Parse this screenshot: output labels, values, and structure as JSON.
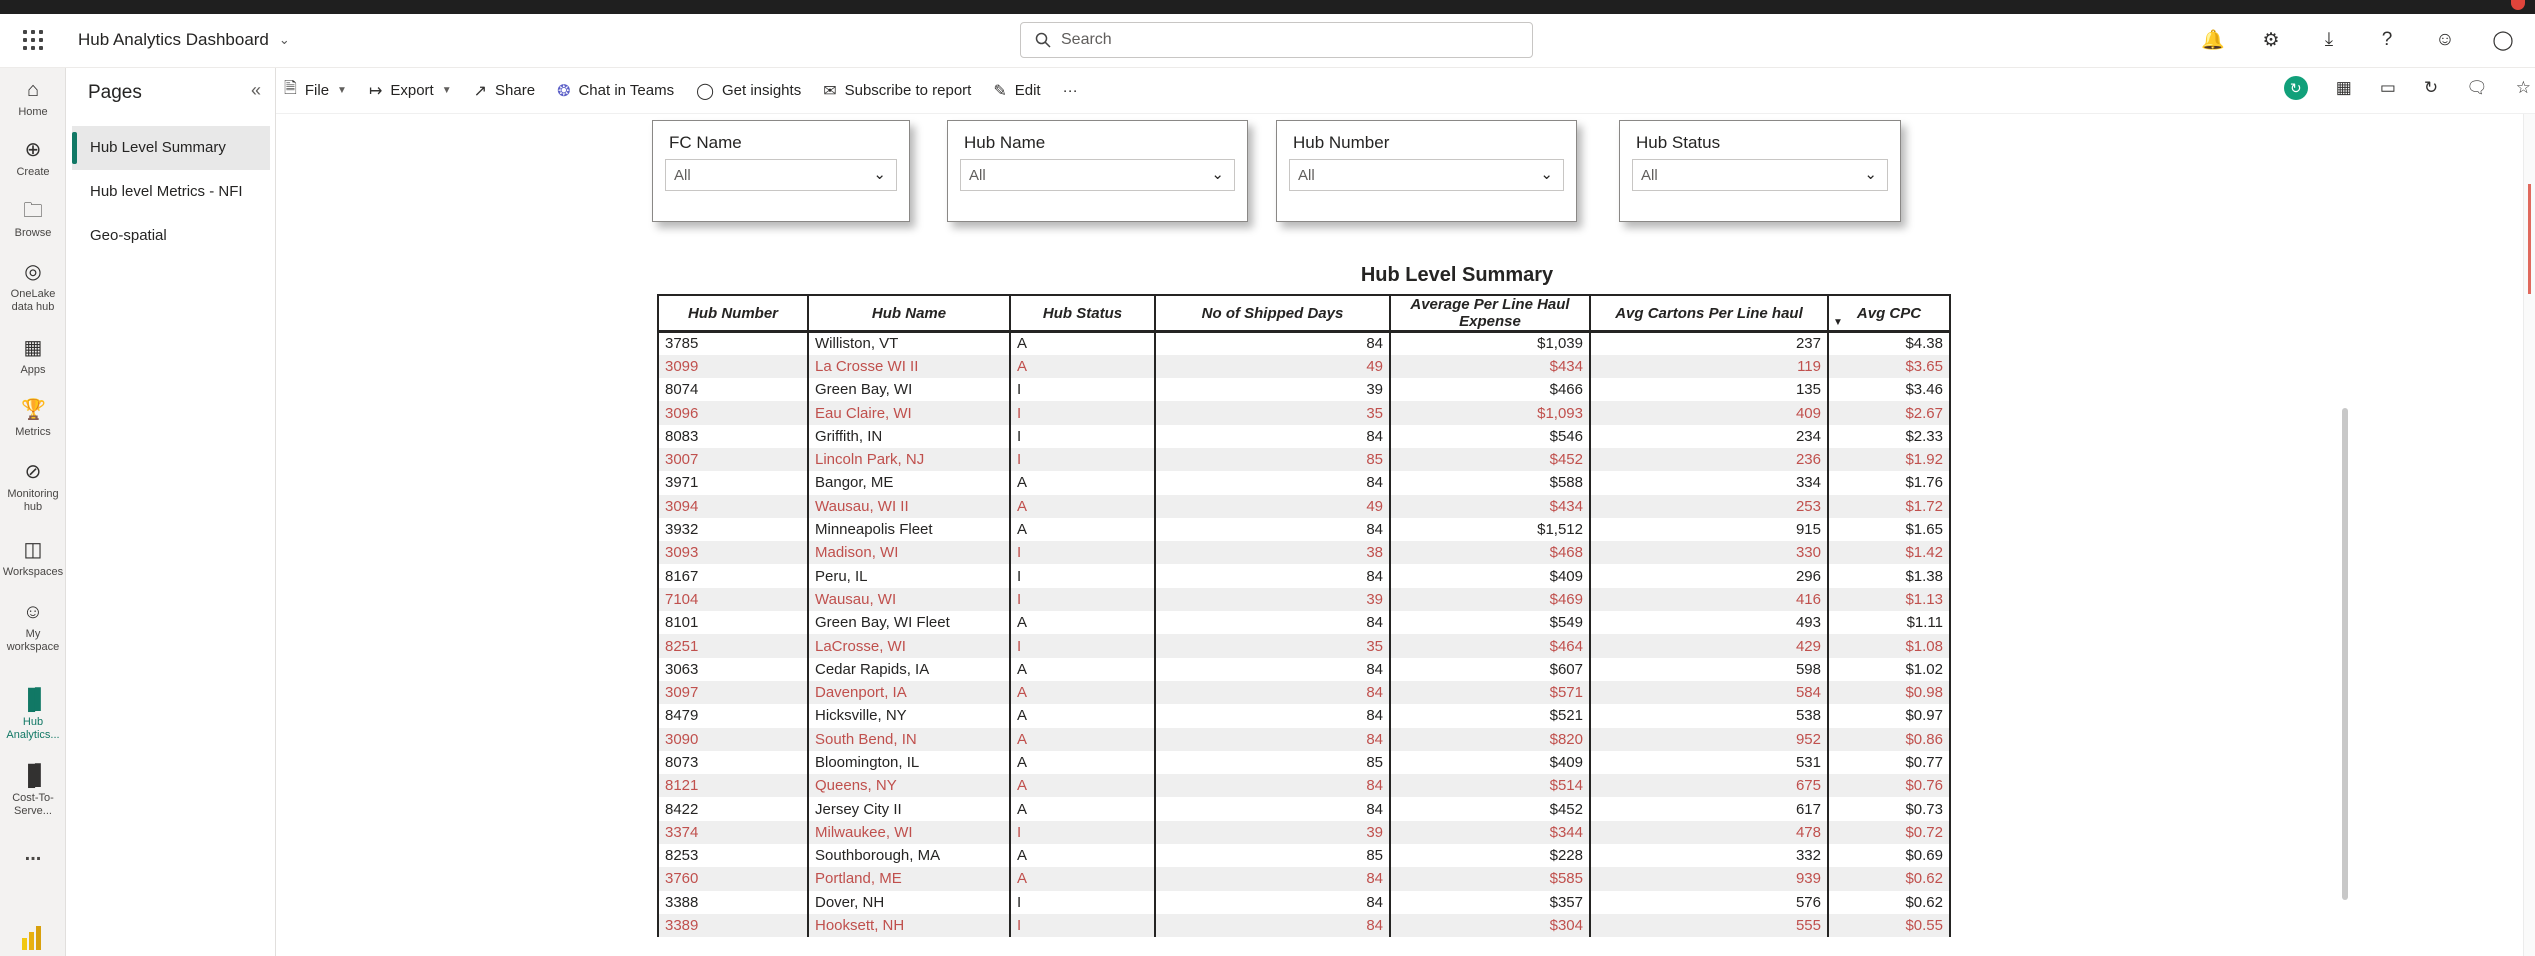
{
  "header": {
    "app_title": "Hub Analytics Dashboard",
    "search_placeholder": "Search"
  },
  "rail": {
    "items": [
      {
        "label": "Home",
        "icon": "home-icon"
      },
      {
        "label": "Create",
        "icon": "plus-circle-icon"
      },
      {
        "label": "Browse",
        "icon": "folder-icon"
      },
      {
        "label": "OneLake data hub",
        "icon": "onelake-icon"
      },
      {
        "label": "Apps",
        "icon": "apps-icon"
      },
      {
        "label": "Metrics",
        "icon": "trophy-icon"
      },
      {
        "label": "Monitoring hub",
        "icon": "monitor-icon"
      },
      {
        "label": "Workspaces",
        "icon": "workspaces-icon"
      },
      {
        "label": "My workspace",
        "icon": "person-icon"
      },
      {
        "label": "Hub Analytics...",
        "icon": "report-icon"
      },
      {
        "label": "Cost-To-Serve...",
        "icon": "report-icon"
      },
      {
        "label": "...",
        "icon": "more-icon"
      }
    ]
  },
  "pages": {
    "title": "Pages",
    "items": [
      {
        "label": "Hub Level Summary"
      },
      {
        "label": "Hub level Metrics - NFI"
      },
      {
        "label": "Geo-spatial"
      }
    ]
  },
  "toolbar": {
    "file": "File",
    "export": "Export",
    "share": "Share",
    "chat": "Chat in Teams",
    "insights": "Get insights",
    "subscribe": "Subscribe to report",
    "edit": "Edit",
    "more": "···"
  },
  "slicers": [
    {
      "title": "FC Name",
      "value": "All"
    },
    {
      "title": "Hub Name",
      "value": "All"
    },
    {
      "title": "Hub Number",
      "value": "All"
    },
    {
      "title": "Hub Status",
      "value": "All"
    }
  ],
  "table": {
    "title": "Hub Level Summary",
    "columns": [
      "Hub Number",
      "Hub Name",
      "Hub Status",
      "No of Shipped Days",
      "Average Per Line Haul Expense",
      "Avg Cartons Per Line haul",
      "Avg CPC"
    ],
    "rows": [
      [
        "3785",
        "Williston, VT",
        "A",
        "84",
        "$1,039",
        "237",
        "$4.38"
      ],
      [
        "3099",
        "La Crosse WI II",
        "A",
        "49",
        "$434",
        "119",
        "$3.65"
      ],
      [
        "8074",
        "Green Bay, WI",
        "I",
        "39",
        "$466",
        "135",
        "$3.46"
      ],
      [
        "3096",
        "Eau Claire, WI",
        "I",
        "35",
        "$1,093",
        "409",
        "$2.67"
      ],
      [
        "8083",
        "Griffith, IN",
        "I",
        "84",
        "$546",
        "234",
        "$2.33"
      ],
      [
        "3007",
        "Lincoln Park, NJ",
        "I",
        "85",
        "$452",
        "236",
        "$1.92"
      ],
      [
        "3971",
        "Bangor, ME",
        "A",
        "84",
        "$588",
        "334",
        "$1.76"
      ],
      [
        "3094",
        "Wausau, WI II",
        "A",
        "49",
        "$434",
        "253",
        "$1.72"
      ],
      [
        "3932",
        "Minneapolis Fleet",
        "A",
        "84",
        "$1,512",
        "915",
        "$1.65"
      ],
      [
        "3093",
        "Madison, WI",
        "I",
        "38",
        "$468",
        "330",
        "$1.42"
      ],
      [
        "8167",
        "Peru, IL",
        "I",
        "84",
        "$409",
        "296",
        "$1.38"
      ],
      [
        "7104",
        "Wausau, WI",
        "I",
        "39",
        "$469",
        "416",
        "$1.13"
      ],
      [
        "8101",
        "Green Bay, WI Fleet",
        "A",
        "84",
        "$549",
        "493",
        "$1.11"
      ],
      [
        "8251",
        "LaCrosse, WI",
        "I",
        "35",
        "$464",
        "429",
        "$1.08"
      ],
      [
        "3063",
        "Cedar Rapids, IA",
        "A",
        "84",
        "$607",
        "598",
        "$1.02"
      ],
      [
        "3097",
        "Davenport, IA",
        "A",
        "84",
        "$571",
        "584",
        "$0.98"
      ],
      [
        "8479",
        "Hicksville, NY",
        "A",
        "84",
        "$521",
        "538",
        "$0.97"
      ],
      [
        "3090",
        "South Bend, IN",
        "A",
        "84",
        "$820",
        "952",
        "$0.86"
      ],
      [
        "8073",
        "Bloomington, IL",
        "A",
        "85",
        "$409",
        "531",
        "$0.77"
      ],
      [
        "8121",
        "Queens, NY",
        "A",
        "84",
        "$514",
        "675",
        "$0.76"
      ],
      [
        "8422",
        "Jersey City II",
        "A",
        "84",
        "$452",
        "617",
        "$0.73"
      ],
      [
        "3374",
        "Milwaukee, WI",
        "I",
        "39",
        "$344",
        "478",
        "$0.72"
      ],
      [
        "8253",
        "Southborough, MA",
        "A",
        "85",
        "$228",
        "332",
        "$0.69"
      ],
      [
        "3760",
        "Portland, ME",
        "A",
        "84",
        "$585",
        "939",
        "$0.62"
      ],
      [
        "3388",
        "Dover, NH",
        "I",
        "84",
        "$357",
        "576",
        "$0.62"
      ],
      [
        "3389",
        "Hooksett, NH",
        "I",
        "84",
        "$304",
        "555",
        "$0.55"
      ]
    ]
  },
  "colors": {
    "accent": "#117865",
    "alt_row_text": "#c0504d",
    "alt_row_bg": "#efefef"
  }
}
